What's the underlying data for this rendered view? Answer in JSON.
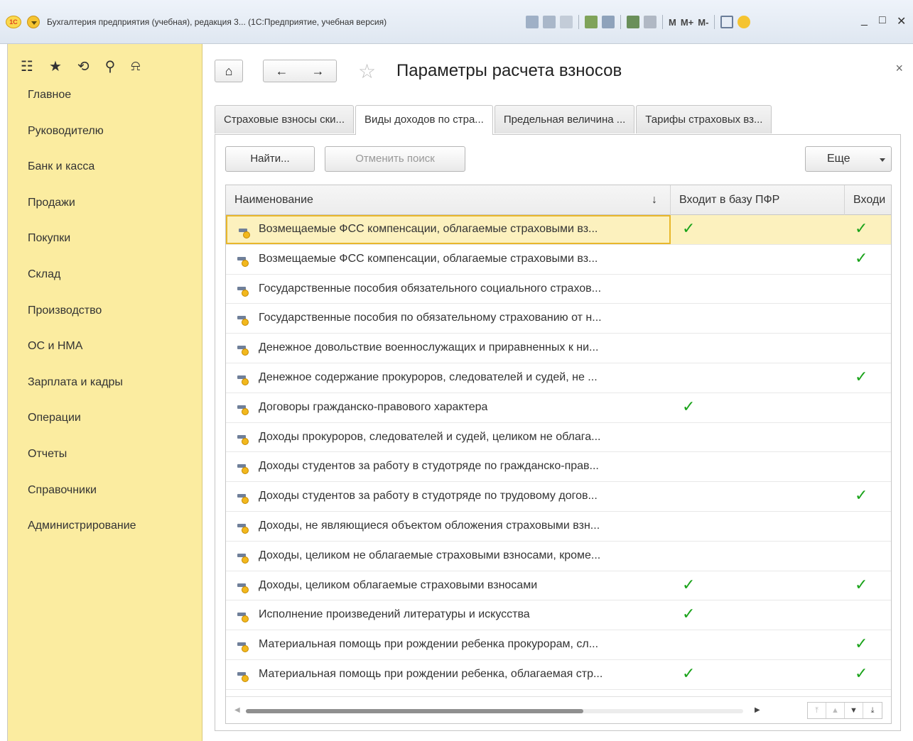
{
  "window": {
    "title": "Бухгалтерия предприятия (учебная), редакция 3... (1С:Предприятие, учебная версия)",
    "logo_text": "1С",
    "mm_labels": [
      "M",
      "M+",
      "M-"
    ],
    "controls": [
      "_",
      "□",
      "✕"
    ]
  },
  "sidebar": {
    "top_icons": [
      "apps-icon",
      "star-icon",
      "history-icon",
      "search-icon",
      "bell-icon"
    ],
    "items": [
      {
        "label": "Главное"
      },
      {
        "label": "Руководителю"
      },
      {
        "label": "Банк и касса"
      },
      {
        "label": "Продажи"
      },
      {
        "label": "Покупки"
      },
      {
        "label": "Склад"
      },
      {
        "label": "Производство"
      },
      {
        "label": "ОС и НМА"
      },
      {
        "label": "Зарплата и кадры"
      },
      {
        "label": "Операции"
      },
      {
        "label": "Отчеты"
      },
      {
        "label": "Справочники"
      },
      {
        "label": "Администрирование"
      }
    ]
  },
  "page": {
    "title": "Параметры расчета взносов",
    "home_icon": "home-icon",
    "back_icon": "back-arrow-icon",
    "forward_icon": "forward-arrow-icon",
    "close_glyph": "×"
  },
  "tabs": [
    {
      "label": "Страховые взносы ски..."
    },
    {
      "label": "Виды доходов по стра...",
      "active": true
    },
    {
      "label": "Предельная величина ..."
    },
    {
      "label": "Тарифы страховых вз..."
    }
  ],
  "toolbar": {
    "find_label": "Найти...",
    "cancel_search_label": "Отменить поиск",
    "more_label": "Еще"
  },
  "table": {
    "columns": [
      "Наименование",
      "Входит в базу ПФР",
      "Входи"
    ],
    "sort_indicator": "↓",
    "rows": [
      {
        "name": "Возмещаемые ФСС компенсации, облагаемые страховыми вз...",
        "pfr": true,
        "next": true,
        "selected": true
      },
      {
        "name": "Возмещаемые ФСС компенсации, облагаемые страховыми вз...",
        "pfr": false,
        "next": true
      },
      {
        "name": "Государственные пособия обязательного социального страхов...",
        "pfr": false,
        "next": false
      },
      {
        "name": "Государственные пособия по обязательному страхованию от н...",
        "pfr": false,
        "next": false
      },
      {
        "name": "Денежное довольствие военнослужащих и приравненных к ни...",
        "pfr": false,
        "next": false
      },
      {
        "name": "Денежное содержание прокуроров, следователей и судей, не ...",
        "pfr": false,
        "next": true
      },
      {
        "name": "Договоры гражданско-правового характера",
        "pfr": true,
        "next": false
      },
      {
        "name": "Доходы прокуроров, следователей и судей, целиком не облага...",
        "pfr": false,
        "next": false
      },
      {
        "name": "Доходы студентов за работу в студотряде по гражданско-прав...",
        "pfr": false,
        "next": false
      },
      {
        "name": "Доходы студентов за работу в студотряде по трудовому догов...",
        "pfr": false,
        "next": true
      },
      {
        "name": "Доходы, не являющиеся объектом обложения страховыми взн...",
        "pfr": false,
        "next": false
      },
      {
        "name": "Доходы, целиком не облагаемые страховыми взносами, кроме...",
        "pfr": false,
        "next": false
      },
      {
        "name": "Доходы, целиком облагаемые страховыми взносами",
        "pfr": true,
        "next": true
      },
      {
        "name": "Исполнение произведений литературы и искусства",
        "pfr": true,
        "next": false
      },
      {
        "name": "Материальная помощь при рождении ребенка прокурорам, сл...",
        "pfr": false,
        "next": true
      },
      {
        "name": "Материальная помощь при рождении ребенка, облагаемая стр...",
        "pfr": true,
        "next": true
      }
    ],
    "check_glyph": "✓"
  },
  "colors": {
    "sidebar_bg": "#fbeca0",
    "selected_row_bg": "#fcf1be",
    "selected_border": "#e8b72b",
    "check_green": "#1aa31a"
  }
}
